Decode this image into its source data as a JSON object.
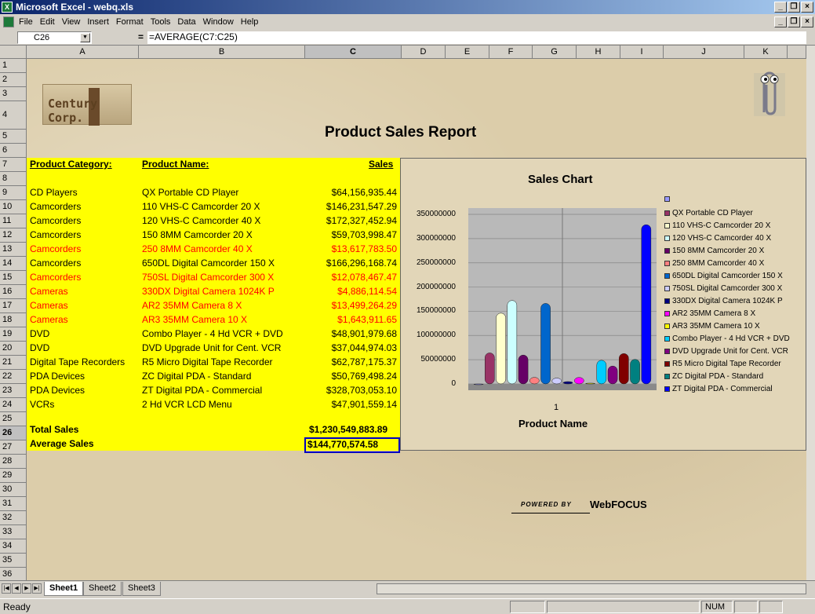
{
  "window": {
    "title": "Microsoft Excel - webq.xls"
  },
  "menu": [
    "File",
    "Edit",
    "View",
    "Insert",
    "Format",
    "Tools",
    "Data",
    "Window",
    "Help"
  ],
  "formula_bar": {
    "name_box": "C26",
    "formula": "=AVERAGE(C7:C25)"
  },
  "columns": [
    "A",
    "B",
    "C",
    "D",
    "E",
    "F",
    "G",
    "H",
    "I",
    "J",
    "K"
  ],
  "rows": [
    "1",
    "2",
    "3",
    "4",
    "5",
    "6",
    "7",
    "8",
    "9",
    "10",
    "11",
    "12",
    "13",
    "14",
    "15",
    "16",
    "17",
    "18",
    "19",
    "20",
    "21",
    "22",
    "23",
    "24",
    "25",
    "26",
    "27",
    "28",
    "29",
    "30",
    "31",
    "32",
    "33",
    "34",
    "35",
    "36"
  ],
  "logo_text": "Century Corp.",
  "report_title": "Product Sales Report",
  "headers": {
    "category": "Product Category:",
    "name": "Product Name:",
    "sales": "Sales"
  },
  "table_rows": [
    {
      "category": "CD Players",
      "name": "QX Portable CD Player",
      "sales": "$64,156,935.44",
      "red": false
    },
    {
      "category": "Camcorders",
      "name": "110 VHS-C Camcorder 20 X",
      "sales": "$146,231,547.29",
      "red": false
    },
    {
      "category": "Camcorders",
      "name": "120 VHS-C Camcorder 40 X",
      "sales": "$172,327,452.94",
      "red": false
    },
    {
      "category": "Camcorders",
      "name": "150 8MM Camcorder 20 X",
      "sales": "$59,703,998.47",
      "red": false
    },
    {
      "category": "Camcorders",
      "name": "250 8MM Camcorder 40 X",
      "sales": "$13,617,783.50",
      "red": true
    },
    {
      "category": "Camcorders",
      "name": "650DL Digital Camcorder 150 X",
      "sales": "$166,296,168.74",
      "red": false
    },
    {
      "category": "Camcorders",
      "name": "750SL Digital Camcorder 300 X",
      "sales": "$12,078,467.47",
      "red": true
    },
    {
      "category": "Cameras",
      "name": "330DX Digital Camera 1024K P",
      "sales": "$4,886,114.54",
      "red": true
    },
    {
      "category": "Cameras",
      "name": "AR2 35MM Camera 8 X",
      "sales": "$13,499,264.29",
      "red": true
    },
    {
      "category": "Cameras",
      "name": "AR3 35MM Camera 10 X",
      "sales": "$1,643,911.65",
      "red": true
    },
    {
      "category": "DVD",
      "name": "Combo Player - 4 Hd VCR + DVD",
      "sales": "$48,901,979.68",
      "red": false
    },
    {
      "category": "DVD",
      "name": "DVD Upgrade Unit for Cent. VCR",
      "sales": "$37,044,974.03",
      "red": false
    },
    {
      "category": "Digital Tape Recorders",
      "name": "R5 Micro Digital Tape Recorder",
      "sales": "$62,787,175.37",
      "red": false
    },
    {
      "category": "PDA Devices",
      "name": "ZC Digital PDA - Standard",
      "sales": "$50,769,498.24",
      "red": false
    },
    {
      "category": "PDA Devices",
      "name": "ZT Digital PDA - Commercial",
      "sales": "$328,703,053.10",
      "red": false
    },
    {
      "category": "VCRs",
      "name": "2 Hd VCR LCD Menu",
      "sales": "$47,901,559.14",
      "red": false
    }
  ],
  "totals": {
    "total_label": "Total Sales",
    "total_value": "$1,230,549,883.89",
    "avg_label": "Average Sales",
    "avg_value": "$144,770,574.58"
  },
  "powered_by": {
    "prefix": "POWERED BY",
    "brand": "WebFOCUS"
  },
  "sheet_tabs": [
    "Sheet1",
    "Sheet2",
    "Sheet3"
  ],
  "status": {
    "text": "Ready",
    "num": "NUM"
  },
  "chart_data": {
    "type": "bar",
    "title": "Sales Chart",
    "xlabel": "Product Name",
    "categories": [
      "1"
    ],
    "ylim": [
      0,
      350000000
    ],
    "yticks": [
      "0",
      "50000000",
      "100000000",
      "150000000",
      "200000000",
      "250000000",
      "300000000",
      "350000000"
    ],
    "legend_position": "right",
    "series": [
      {
        "name": "",
        "values": [
          0
        ],
        "color": "#9999ff"
      },
      {
        "name": "QX Portable CD Player",
        "values": [
          64156935
        ],
        "color": "#993366"
      },
      {
        "name": "110 VHS-C Camcorder 20 X",
        "values": [
          146231547
        ],
        "color": "#ffffcc"
      },
      {
        "name": "120 VHS-C Camcorder 40 X",
        "values": [
          172327453
        ],
        "color": "#ccffff"
      },
      {
        "name": "150 8MM Camcorder 20 X",
        "values": [
          59703998
        ],
        "color": "#660066"
      },
      {
        "name": "250 8MM Camcorder 40 X",
        "values": [
          13617784
        ],
        "color": "#ff8080"
      },
      {
        "name": "650DL Digital Camcorder 150 X",
        "values": [
          166296169
        ],
        "color": "#0066cc"
      },
      {
        "name": "750SL Digital Camcorder 300 X",
        "values": [
          12078467
        ],
        "color": "#ccccff"
      },
      {
        "name": "330DX Digital Camera 1024K P",
        "values": [
          4886115
        ],
        "color": "#000080"
      },
      {
        "name": "AR2 35MM Camera 8 X",
        "values": [
          13499264
        ],
        "color": "#ff00ff"
      },
      {
        "name": "AR3 35MM Camera 10 X",
        "values": [
          1643912
        ],
        "color": "#ffff00"
      },
      {
        "name": "Combo Player - 4 Hd VCR + DVD",
        "values": [
          48901980
        ],
        "color": "#00ccff"
      },
      {
        "name": "DVD Upgrade Unit for Cent. VCR",
        "values": [
          37044974
        ],
        "color": "#800080"
      },
      {
        "name": "R5 Micro Digital Tape Recorder",
        "values": [
          62787175
        ],
        "color": "#800000"
      },
      {
        "name": "ZC Digital PDA - Standard",
        "values": [
          50769498
        ],
        "color": "#008080"
      },
      {
        "name": "ZT Digital PDA - Commercial",
        "values": [
          328703053
        ],
        "color": "#0000ff"
      }
    ]
  }
}
